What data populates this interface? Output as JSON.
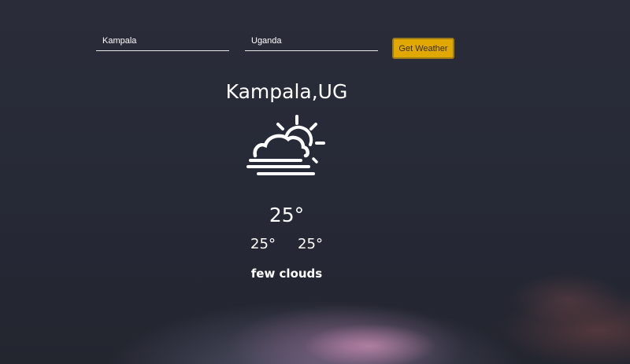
{
  "search": {
    "city_value": "Kampala",
    "country_value": "Uganda",
    "button_label": "Get Weather"
  },
  "weather": {
    "location": "Kampala,UG",
    "icon": "sun-behind-cloud-fog-icon",
    "temperature": "25°",
    "temp_min": "25°",
    "temp_max": "25°",
    "description": "few clouds"
  },
  "colors": {
    "background": "#262a37",
    "button": "#e0a800",
    "text": "#ffffff"
  }
}
